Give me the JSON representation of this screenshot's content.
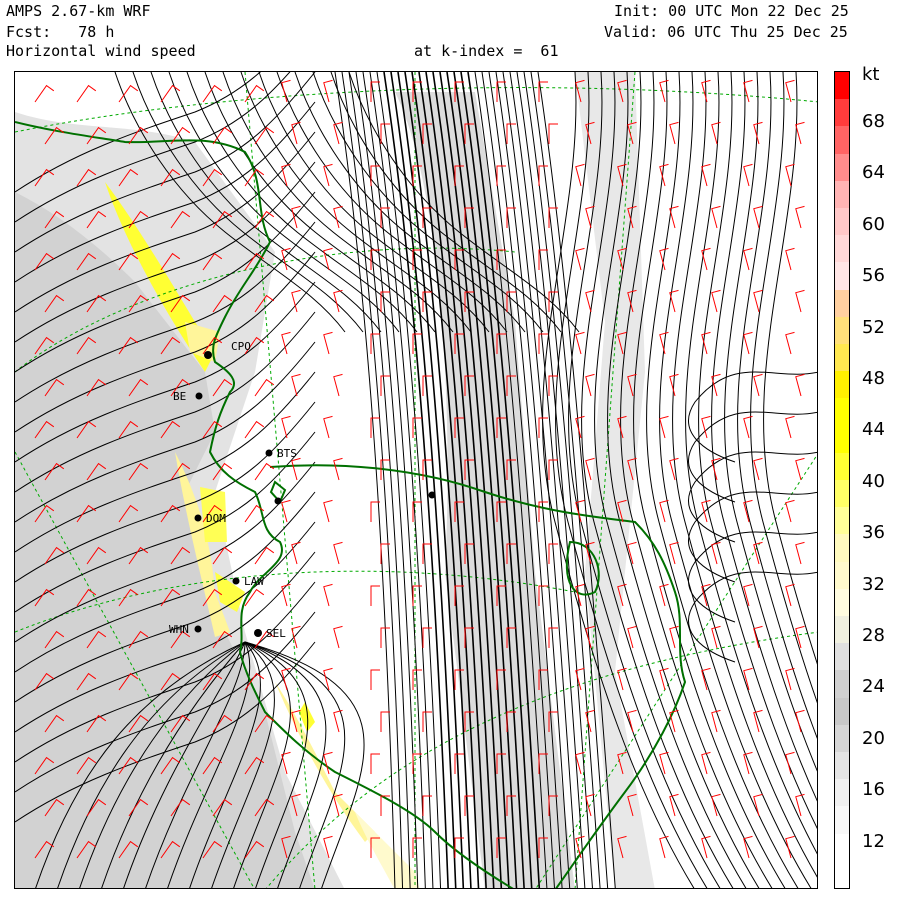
{
  "header": {
    "model": "AMPS 2.67-km WRF",
    "forecast": "Fcst:   78 h",
    "field": "Horizontal wind speed",
    "level": "at k-index =  61",
    "init": "Init: 00 UTC Mon 22 Dec 25",
    "valid": "Valid: 06 UTC Thu 25 Dec 25"
  },
  "stations": [
    {
      "code": "CPO"
    },
    {
      "code": "BE"
    },
    {
      "code": "BTS"
    },
    {
      "code": "DOM"
    },
    {
      "code": "LAW"
    },
    {
      "code": "WHN"
    },
    {
      "code": "SEL"
    }
  ],
  "colorbar": {
    "unit": "kt",
    "labels": [
      "68",
      "64",
      "60",
      "56",
      "52",
      "48",
      "44",
      "40",
      "36",
      "32",
      "28",
      "24",
      "20",
      "16",
      "12"
    ],
    "colors": {
      "white": "#ffffff",
      "light_gray": "#e6e6e6",
      "mid_gray": "#c8c8c8",
      "pale_yellow": "#fffacd",
      "yellow": "#ffff00",
      "orange": "#ffc878",
      "pink": "#ffc8c8",
      "red": "#ff0000"
    }
  },
  "map_colors": {
    "streamline": "#000000",
    "coastline": "#007000",
    "grid": "#00aa00",
    "barb": "#ff0000"
  }
}
